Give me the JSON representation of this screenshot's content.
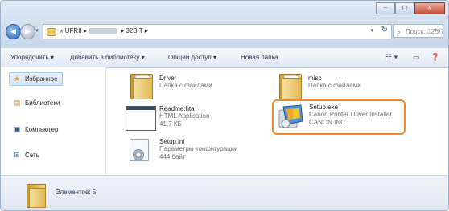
{
  "window": {
    "caption_buttons": [
      "–",
      "▢",
      "✕"
    ]
  },
  "address": {
    "crumbs": [
      "«",
      "UFRII",
      "▸",
      "▸",
      "32BIT",
      "▸"
    ],
    "search_placeholder": "Поиск: 32BIT"
  },
  "commands": {
    "organize": "Упорядочить ▾",
    "add_library": "Добавить в библиотеку ▾",
    "share": "Общий доступ ▾",
    "new_folder": "Новая папка"
  },
  "sidebar": {
    "items": [
      {
        "label": "Избранное",
        "icon": "star-icon"
      },
      {
        "label": "Библиотеки",
        "icon": "libraries-icon"
      },
      {
        "label": "Компьютер",
        "icon": "computer-icon"
      },
      {
        "label": "Сеть",
        "icon": "network-icon"
      }
    ]
  },
  "files": [
    {
      "name": "Driver",
      "meta1": "Папка с файлами",
      "meta2": "",
      "icon": "folder-icon"
    },
    {
      "name": "misc",
      "meta1": "Папка с файлами",
      "meta2": "",
      "icon": "folder-icon"
    },
    {
      "name": "Readme.hta",
      "meta1": "HTML Application",
      "meta2": "41,7 КБ",
      "icon": "hta-file-icon"
    },
    {
      "name": "Setup.exe",
      "meta1": "Canon Printer Driver Installer",
      "meta2": "CANON INC.",
      "icon": "setup-installer-icon"
    },
    {
      "name": "Setup.ini",
      "meta1": "Параметры конфигурации",
      "meta2": "444 байт",
      "icon": "ini-config-icon"
    }
  ],
  "status": {
    "text": "Элементов: 5"
  },
  "colors": {
    "highlight": "#f08a2a",
    "accent": "#2f69b6"
  }
}
